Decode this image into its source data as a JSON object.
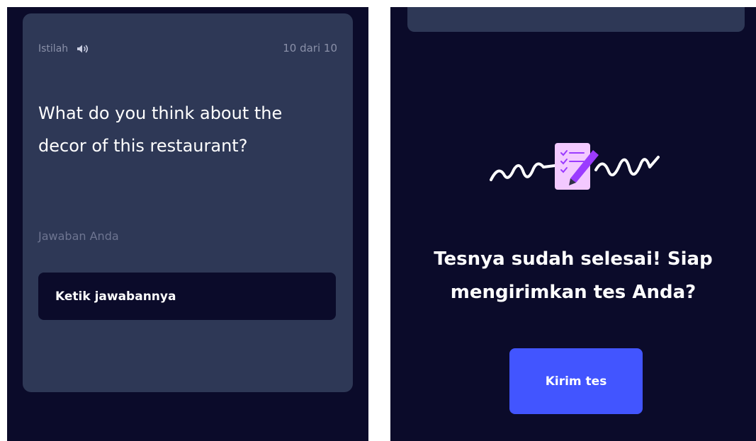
{
  "left_panel": {
    "card": {
      "term_label": "Istilah",
      "counter": "10 dari 10",
      "question": "What do you think about the decor of this restaurant?",
      "answer_label": "Jawaban Anda",
      "answer_placeholder": "Ketik jawabannya",
      "answer_value": ""
    }
  },
  "right_panel": {
    "done_title": "Tesnya sudah selesai! Siap mengirimkan tes Anda?",
    "submit_label": "Kirim tes"
  },
  "icons": {
    "sound": "speaker-icon",
    "illustration": "signed-checklist-illustration"
  },
  "colors": {
    "background": "#0b0b2a",
    "card": "#2e3856",
    "accent": "#4255ff",
    "muted_text": "#8a90a8",
    "illustration_paper": "#f3c9ff",
    "illustration_pencil": "#9b3bff"
  }
}
